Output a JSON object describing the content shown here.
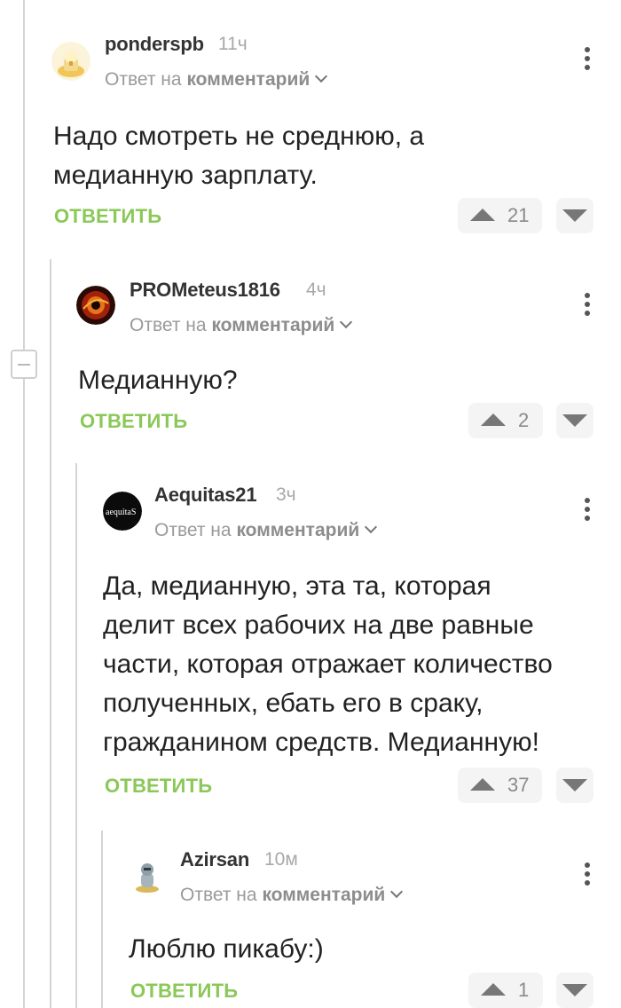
{
  "comments": [
    {
      "username": "ponderspb",
      "time": "11ч",
      "reply_prefix": "Ответ на",
      "reply_target": "комментарий",
      "text": [
        "Надо смотреть не среднюю, а",
        "медианную зарплату."
      ],
      "reply_label": "ОТВЕТИТЬ",
      "rating": "21"
    },
    {
      "username": "PROMeteus1816",
      "time": "4ч",
      "reply_prefix": "Ответ на",
      "reply_target": "комментарий",
      "text": [
        "Медианную?"
      ],
      "reply_label": "ОТВЕТИТЬ",
      "rating": "2"
    },
    {
      "username": "Aequitas21",
      "time": "3ч",
      "reply_prefix": "Ответ на",
      "reply_target": "комментарий",
      "avatar_text": "aequitaS",
      "text": [
        "Да, медианную, эта та, которая",
        "делит всех рабочих на две равные",
        "части, которая отражает количество",
        "полученных, ебать его в сраку,",
        "гражданином средств. Медианную!"
      ],
      "reply_label": "ОТВЕТИТЬ",
      "rating": "37"
    },
    {
      "username": "Azirsan",
      "time": "10м",
      "reply_prefix": "Ответ на",
      "reply_target": "комментарий",
      "text": [
        "Люблю пикабу:)"
      ],
      "reply_label": "ОТВЕТИТЬ",
      "rating": "1"
    }
  ],
  "colors": {
    "accent_green": "#8ac858",
    "thread_line": "#d4d4d4",
    "vote_bg": "#f4f4f4"
  }
}
